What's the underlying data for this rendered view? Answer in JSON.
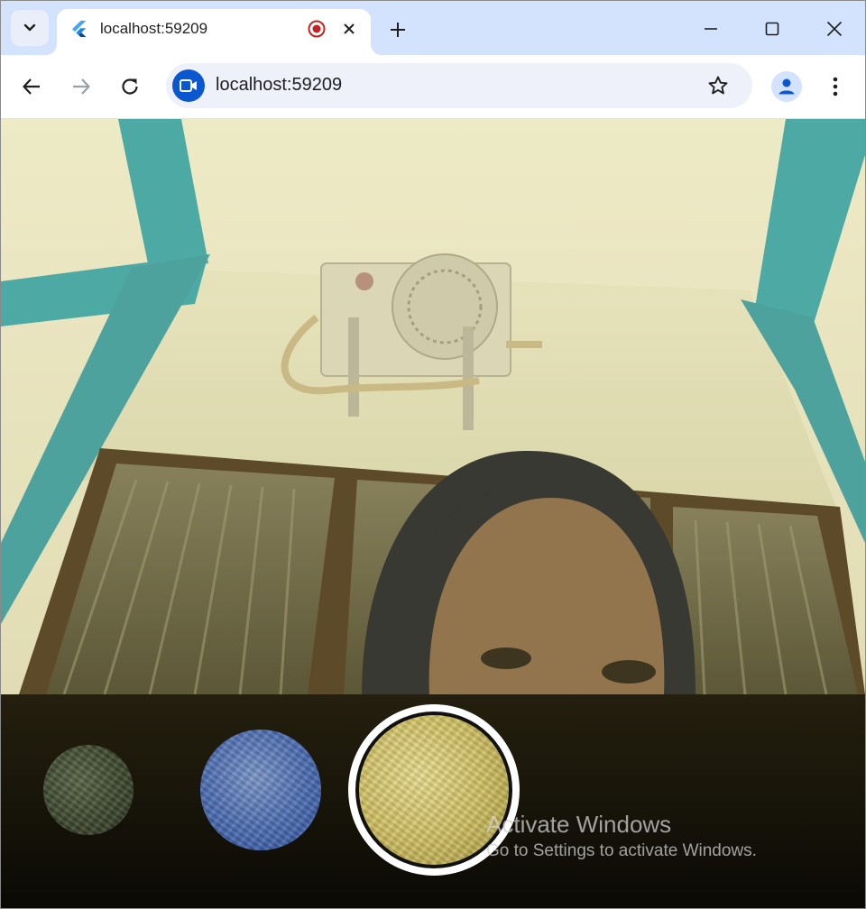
{
  "browser": {
    "tab": {
      "title": "localhost:59209"
    },
    "address_bar": {
      "url": "localhost:59209"
    }
  },
  "camera": {
    "description_icon": "camera-feed"
  },
  "filters": [
    {
      "name": "green-filter",
      "color": "#4b5a3b"
    },
    {
      "name": "blue-filter",
      "color": "#4d6fb4"
    },
    {
      "name": "yellow-filter",
      "color": "#d2c265",
      "selected": true
    }
  ],
  "watermark": {
    "title": "Activate Windows",
    "subtitle": "Go to Settings to activate Windows."
  },
  "colors": {
    "tabstrip": "#d3e3fd",
    "accent": "#0b57d0",
    "filter_bar": "#1f1b0c"
  }
}
